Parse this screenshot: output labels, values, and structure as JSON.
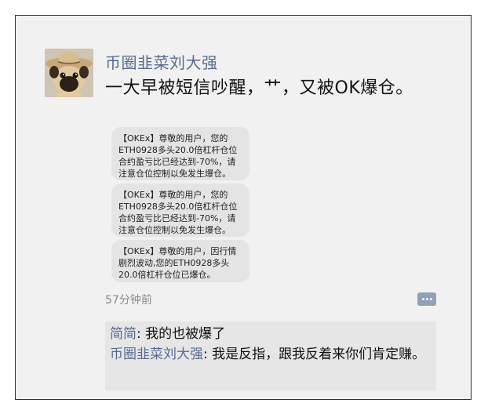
{
  "post": {
    "author": "币圈韭菜刘大强",
    "text": "一大早被短信吵醒，艹，又被OK爆仓。",
    "time": "57分钟前",
    "avatar_icon": "pug-with-cowboy-hat-avatar",
    "comment_icon": "comment-dots-icon"
  },
  "sms_messages": [
    {
      "text": "【OKEx】尊敬的用户，您的\nETH0928多头20.0倍杠杆仓位\n合约盈亏比已经达到-70%，请\n注意仓位控制以免发生爆仓。"
    },
    {
      "text": "【OKEx】尊敬的用户，您的\nETH0928多头20.0倍杠杆仓位\n合约盈亏比已经达到-70%，请\n注意仓位控制以免发生爆仓。"
    },
    {
      "text": "【OKEx】尊敬的用户，因行情\n剧烈波动,您的ETH0928多头\n20.0倍杠杆仓位已爆仓。"
    }
  ],
  "comments": [
    {
      "name": "简简",
      "text": ": 我的也被爆了"
    },
    {
      "name": "币圈韭菜刘大强",
      "text": ": 我是反指，跟我反着来你们肯定赚。"
    }
  ],
  "colors": {
    "link_name": "#566b94",
    "bubble": "#e4e4e4",
    "background": "#f1f1f1",
    "comment_button": "#8fa0b8"
  }
}
